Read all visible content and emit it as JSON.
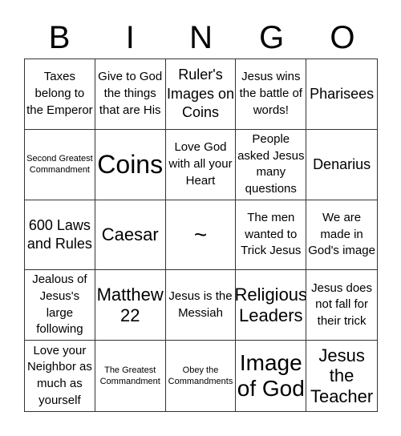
{
  "header": {
    "letters": [
      "B",
      "I",
      "N",
      "G",
      "O"
    ]
  },
  "board": {
    "cells": [
      {
        "text": "Taxes belong to the Emperor",
        "size": "s"
      },
      {
        "text": "Give to God the things that are His",
        "size": "s"
      },
      {
        "text": "Ruler's Images on Coins",
        "size": "m"
      },
      {
        "text": "Jesus wins the battle of words!",
        "size": "s"
      },
      {
        "text": "Pharisees",
        "size": "m"
      },
      {
        "text": "Second Greatest Commandment",
        "size": "xs"
      },
      {
        "text": "Coins",
        "size": "xxl"
      },
      {
        "text": "Love God with all your Heart",
        "size": "s"
      },
      {
        "text": "People asked Jesus many questions",
        "size": "s"
      },
      {
        "text": "Denarius",
        "size": "m"
      },
      {
        "text": "600 Laws and Rules",
        "size": "m"
      },
      {
        "text": "Caesar",
        "size": "l"
      },
      {
        "text": "~",
        "size": "xl"
      },
      {
        "text": "The men wanted to Trick Jesus",
        "size": "s"
      },
      {
        "text": "We are made in God's image",
        "size": "s"
      },
      {
        "text": "Jealous of Jesus's large following",
        "size": "s"
      },
      {
        "text": "Matthew 22",
        "size": "l"
      },
      {
        "text": "Jesus is the Messiah",
        "size": "s"
      },
      {
        "text": "Religious Leaders",
        "size": "l"
      },
      {
        "text": "Jesus does not fall for their trick",
        "size": "s"
      },
      {
        "text": "Love your Neighbor as much as yourself",
        "size": "s"
      },
      {
        "text": "The Greatest Commandment",
        "size": "xs"
      },
      {
        "text": "Obey the Commandments",
        "size": "xs"
      },
      {
        "text": "Image of God",
        "size": "xl"
      },
      {
        "text": "Jesus the Teacher",
        "size": "l"
      }
    ]
  }
}
